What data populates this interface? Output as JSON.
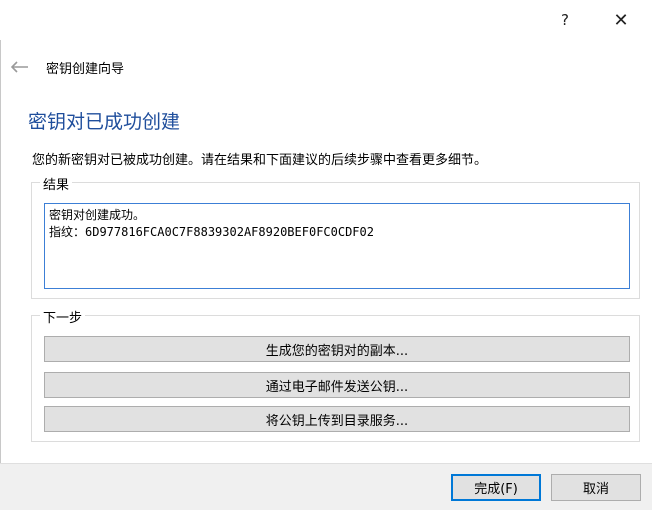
{
  "titlebar": {
    "help_glyph": "?",
    "close_glyph": "✕"
  },
  "header": {
    "back_icon": "arrow-left-icon",
    "wizard_title": "密钥创建向导"
  },
  "page": {
    "title": "密钥对已成功创建",
    "description": "您的新密钥对已被成功创建。请在结果和下面建议的后续步骤中查看更多细节。"
  },
  "result_group": {
    "label": "结果",
    "text": "密钥对创建成功。\n指纹：6D977816FCA0C7F8839302AF8920BEF0FC0CDF02"
  },
  "next_group": {
    "label": "下一步",
    "buttons": [
      "生成您的密钥对的副本...",
      "通过电子邮件发送公钥...",
      "将公钥上传到目录服务..."
    ]
  },
  "footer": {
    "finish_label": "完成(F)",
    "cancel_label": "取消"
  },
  "colors": {
    "title_blue": "#1f4e9c",
    "focus_blue": "#0078d7",
    "field_border": "#3c7fd6"
  }
}
